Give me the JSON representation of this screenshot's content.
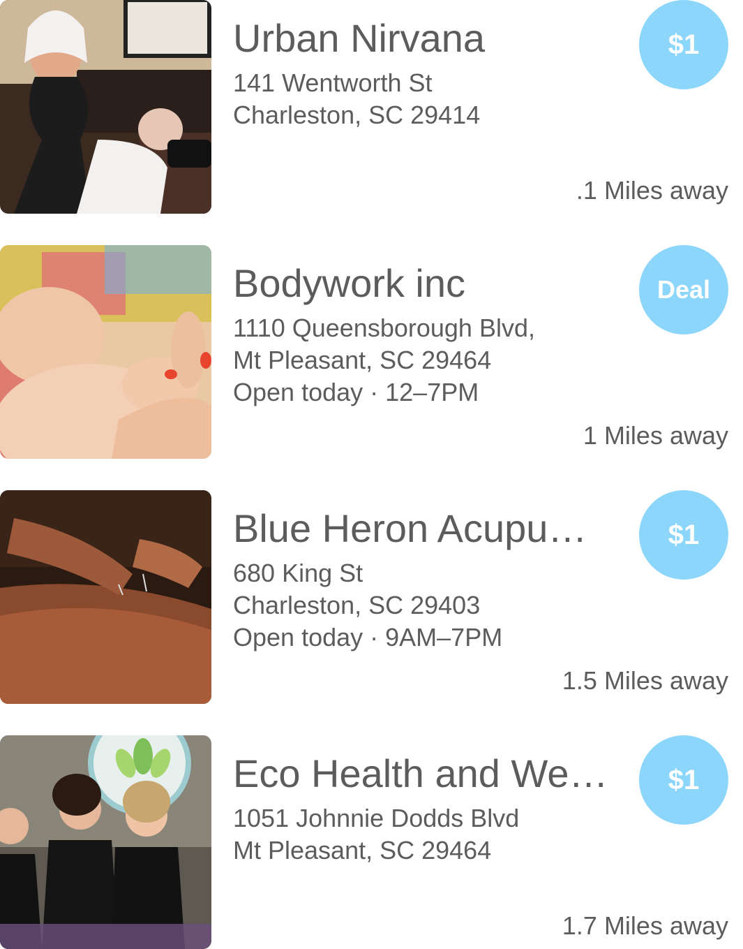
{
  "listings": [
    {
      "name": "Urban Nirvana",
      "address_line1": "141 Wentworth St",
      "address_line2": "Charleston, SC 29414",
      "hours": "",
      "badge": "$1",
      "distance": ".1 Miles away",
      "photo": "massage-photo"
    },
    {
      "name": "Bodywork inc",
      "address_line1": "1110 Queensborough Blvd,",
      "address_line2": "Mt Pleasant, SC 29464",
      "hours": "Open today · 12–7PM",
      "badge": "Deal",
      "distance": "1 Miles away",
      "photo": "baby-foot-massage-photo"
    },
    {
      "name": "Blue Heron Acupu…",
      "address_line1": "680 King St",
      "address_line2": "Charleston, SC 29403",
      "hours": "Open today · 9AM–7PM",
      "badge": "$1",
      "distance": "1.5 Miles away",
      "photo": "acupuncture-photo"
    },
    {
      "name": "Eco Health and We…",
      "address_line1": "1051 Johnnie Dodds Blvd",
      "address_line2": "Mt Pleasant, SC 29464",
      "hours": "",
      "badge": "$1",
      "distance": "1.7 Miles away",
      "photo": "staff-group-photo"
    }
  ],
  "colors": {
    "badge": "#8dd6fb",
    "text": "#5c5c5c",
    "background": "#ffffff"
  }
}
